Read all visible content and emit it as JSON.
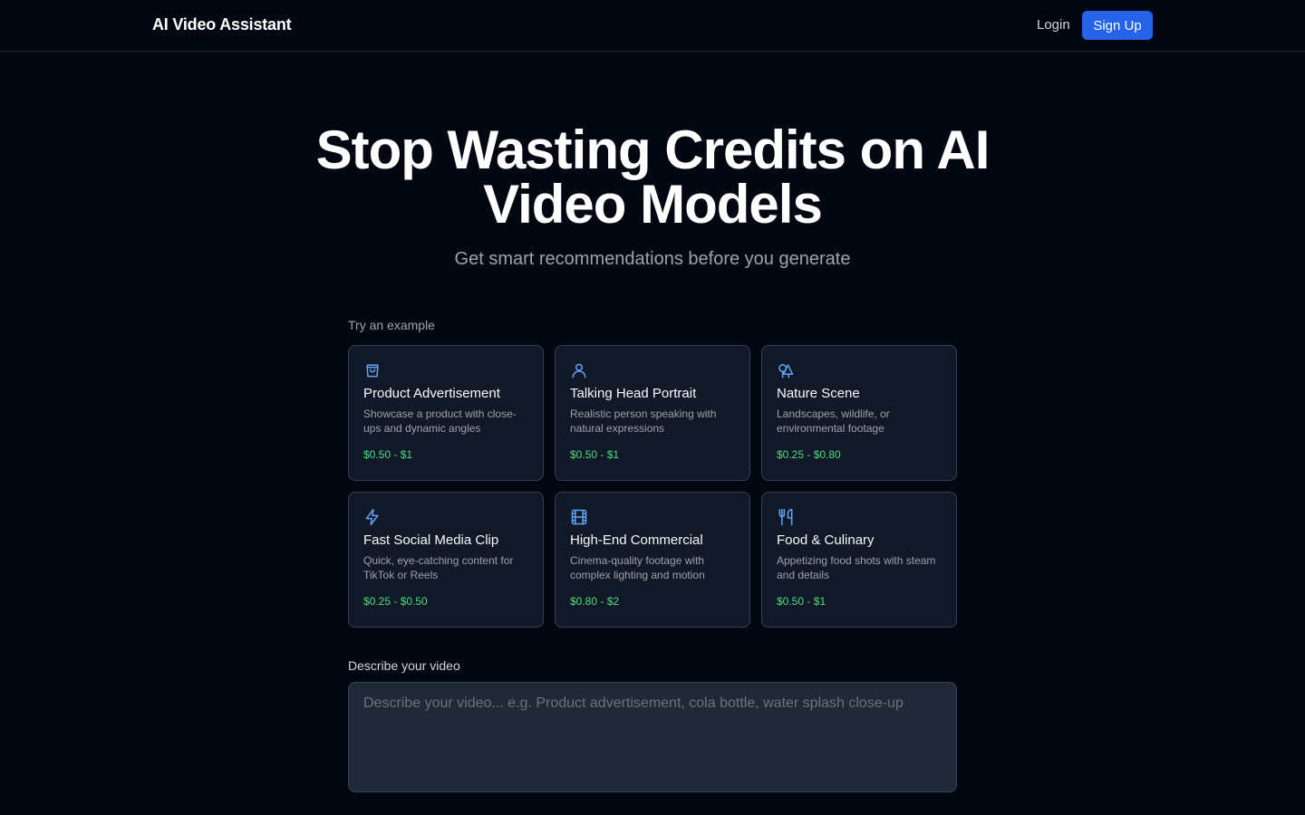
{
  "header": {
    "brand": "AI Video Assistant",
    "login_label": "Login",
    "signup_label": "Sign Up"
  },
  "hero": {
    "title": "Stop Wasting Credits on AI Video Models",
    "subtitle": "Get smart recommendations before you generate"
  },
  "examples": {
    "label": "Try an example",
    "cards": [
      {
        "icon": "shopping-bag-icon",
        "title": "Product Advertisement",
        "description": "Showcase a product with close-ups and dynamic angles",
        "price": "$0.50 - $1"
      },
      {
        "icon": "user-icon",
        "title": "Talking Head Portrait",
        "description": "Realistic person speaking with natural expressions",
        "price": "$0.50 - $1"
      },
      {
        "icon": "trees-icon",
        "title": "Nature Scene",
        "description": "Landscapes, wildlife, or environmental footage",
        "price": "$0.25 - $0.80"
      },
      {
        "icon": "lightning-icon",
        "title": "Fast Social Media Clip",
        "description": "Quick, eye-catching content for TikTok or Reels",
        "price": "$0.25 - $0.50"
      },
      {
        "icon": "film-icon",
        "title": "High-End Commercial",
        "description": "Cinema-quality footage with complex lighting and motion",
        "price": "$0.80 - $2"
      },
      {
        "icon": "utensils-icon",
        "title": "Food & Culinary",
        "description": "Appetizing food shots with steam and details",
        "price": "$0.50 - $1"
      }
    ]
  },
  "describe": {
    "label": "Describe your video",
    "placeholder": "Describe your video... e.g. Product advertisement, cola bottle, water splash close-up",
    "value": ""
  },
  "colors": {
    "background": "#030712",
    "accent": "#2563eb",
    "icon": "#60a5fa",
    "price": "#4ade80"
  }
}
